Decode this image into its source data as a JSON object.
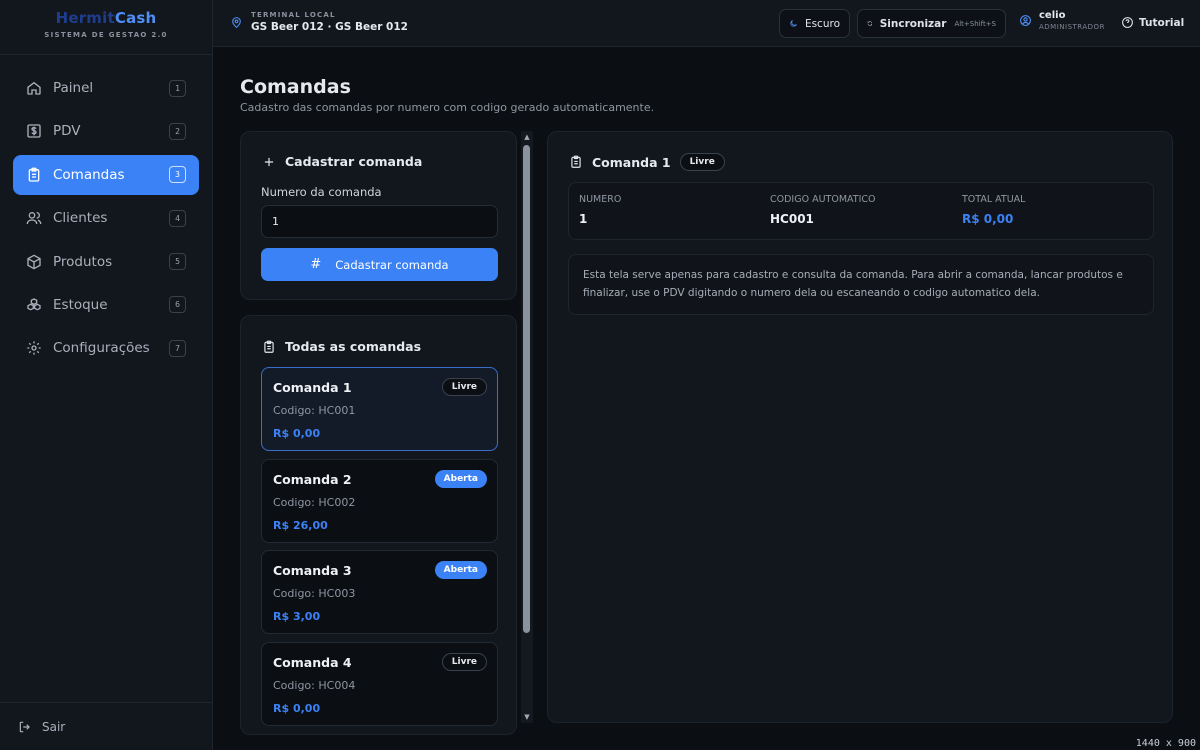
{
  "brand": {
    "name_part1": "Hermit",
    "name_part2": "Cash",
    "subtitle": "SISTEMA DE GESTAO 2.0"
  },
  "sidebar": {
    "items": [
      {
        "label": "Painel",
        "key": "1",
        "icon": "home-icon"
      },
      {
        "label": "PDV",
        "key": "2",
        "icon": "dollar-icon"
      },
      {
        "label": "Comandas",
        "key": "3",
        "icon": "clipboard-icon",
        "active": true
      },
      {
        "label": "Clientes",
        "key": "4",
        "icon": "users-icon"
      },
      {
        "label": "Produtos",
        "key": "5",
        "icon": "box-icon"
      },
      {
        "label": "Estoque",
        "key": "6",
        "icon": "boxes-icon"
      },
      {
        "label": "Configurações",
        "key": "7",
        "icon": "gear-icon"
      }
    ],
    "logout_label": "Sair"
  },
  "topbar": {
    "terminal_label": "TERMINAL LOCAL",
    "terminal_name": "GS Beer 012 · GS Beer 012",
    "theme_label": "Escuro",
    "sync_label": "Sincronizar",
    "sync_shortcut": "Alt+Shift+S",
    "user_name": "celio",
    "user_role": "ADMINISTRADOR",
    "tutorial_label": "Tutorial"
  },
  "page": {
    "title": "Comandas",
    "subtitle": "Cadastro das comandas por numero com codigo gerado automaticamente."
  },
  "register": {
    "title": "Cadastrar comanda",
    "field_label": "Numero da comanda",
    "field_value": "1",
    "button_label": "Cadastrar comanda"
  },
  "list": {
    "title": "Todas as comandas",
    "items": [
      {
        "title": "Comanda 1",
        "code": "Codigo: HC001",
        "total": "R$ 0,00",
        "status": "Livre"
      },
      {
        "title": "Comanda 2",
        "code": "Codigo: HC002",
        "total": "R$ 26,00",
        "status": "Aberta"
      },
      {
        "title": "Comanda 3",
        "code": "Codigo: HC003",
        "total": "R$ 3,00",
        "status": "Aberta"
      },
      {
        "title": "Comanda 4",
        "code": "Codigo: HC004",
        "total": "R$ 0,00",
        "status": "Livre"
      }
    ]
  },
  "detail": {
    "title": "Comanda 1",
    "status": "Livre",
    "numero_label": "NUMERO",
    "numero_value": "1",
    "codigo_label": "CODIGO AUTOMATICO",
    "codigo_value": "HC001",
    "total_label": "TOTAL ATUAL",
    "total_value": "R$ 0,00",
    "description": "Esta tela serve apenas para cadastro e consulta da comanda. Para abrir a comanda, lancar produtos e finalizar, use o PDV digitando o numero dela ou escaneando o codigo automatico dela."
  },
  "resolution": "1440 x 900",
  "colors": {
    "accent": "#3b82f6",
    "background": "#0b0e13",
    "panel": "#12161d"
  }
}
